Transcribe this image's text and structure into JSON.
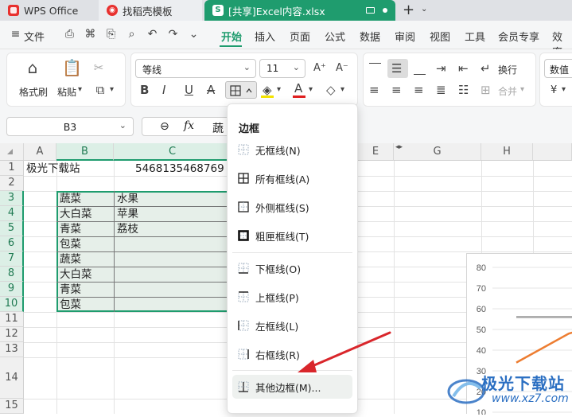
{
  "titlebar": {
    "tabs": [
      {
        "label": "WPS Office"
      },
      {
        "label": "找稻壳模板"
      },
      {
        "label": "[共享]Excel内容.xlsx"
      }
    ]
  },
  "menubar": {
    "file": "文件",
    "tabs": [
      "开始",
      "插入",
      "页面",
      "公式",
      "数据",
      "审阅",
      "视图",
      "工具",
      "会员专享",
      "效率"
    ],
    "active_tab": "开始"
  },
  "ribbon": {
    "format_painter": "格式刷",
    "paste": "粘贴",
    "font_name": "等线",
    "font_size": "11",
    "wrap": "换行",
    "merge": "合并",
    "number_format": "数值",
    "currency": "¥"
  },
  "formula_bar": {
    "name_box": "B3",
    "content": "蔬"
  },
  "grid": {
    "columns": [
      "A",
      "B",
      "C",
      "E",
      "G",
      "H"
    ],
    "rows": [
      "1",
      "2",
      "3",
      "4",
      "5",
      "6",
      "7",
      "8",
      "9",
      "10",
      "11",
      "12",
      "13",
      "14",
      "15"
    ],
    "cells": {
      "A1": "极光下载站",
      "C1": "5468135468769",
      "B3": "蔬菜",
      "C3": "水果",
      "B4": "大白菜",
      "C4": "苹果",
      "B5": "青菜",
      "C5": "荔枝",
      "B6": "包菜",
      "B7": "蔬菜",
      "B8": "大白菜",
      "B9": "青菜",
      "B10": "包菜"
    }
  },
  "chart": {
    "y_ticks": [
      "80",
      "70",
      "60",
      "50",
      "40",
      "30",
      "20",
      "10"
    ]
  },
  "chart_data": {
    "type": "line",
    "ylim": [
      10,
      80
    ],
    "series": [
      {
        "color": "#a5a5a5",
        "values": [
          56,
          56,
          56
        ]
      },
      {
        "color": "#ed7d31",
        "values": [
          34,
          48,
          56
        ]
      }
    ]
  },
  "dropdown": {
    "title": "边框",
    "items": [
      {
        "label": "无框线(N)",
        "icon": "no-border-icon"
      },
      {
        "label": "所有框线(A)",
        "icon": "all-borders-icon"
      },
      {
        "label": "外侧框线(S)",
        "icon": "outside-borders-icon"
      },
      {
        "label": "粗匣框线(T)",
        "icon": "thick-box-border-icon"
      },
      {
        "label": "下框线(O)",
        "icon": "bottom-border-icon"
      },
      {
        "label": "上框线(P)",
        "icon": "top-border-icon"
      },
      {
        "label": "左框线(L)",
        "icon": "left-border-icon"
      },
      {
        "label": "右框线(R)",
        "icon": "right-border-icon"
      },
      {
        "label": "其他边框(M)...",
        "icon": "more-borders-icon"
      }
    ]
  },
  "watermark": {
    "text": "极光下载站",
    "url": "www.xz7.com"
  },
  "colors": {
    "brand_green": "#1f9c6e",
    "selection_fill": "#e6efe9",
    "annotation_arrow": "#d9262b"
  }
}
